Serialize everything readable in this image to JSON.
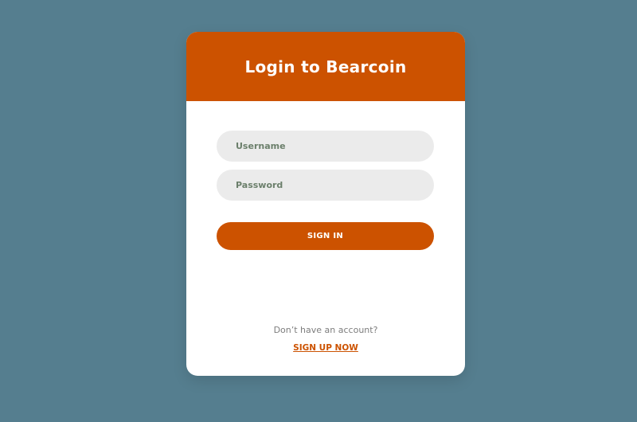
{
  "colors": {
    "page_background": "#557e8f",
    "accent": "#cc5200",
    "card_background": "#ffffff",
    "field_background": "#ebebeb",
    "field_text": "#6b7f6b"
  },
  "login_card": {
    "title": "Login to Bearcoin",
    "username": {
      "placeholder": "Username",
      "value": ""
    },
    "password": {
      "placeholder": "Password",
      "value": ""
    },
    "sign_in_label": "SIGN IN",
    "signup_prompt": "Don’t have an account?",
    "signup_link_label": "SIGN UP NOW"
  }
}
